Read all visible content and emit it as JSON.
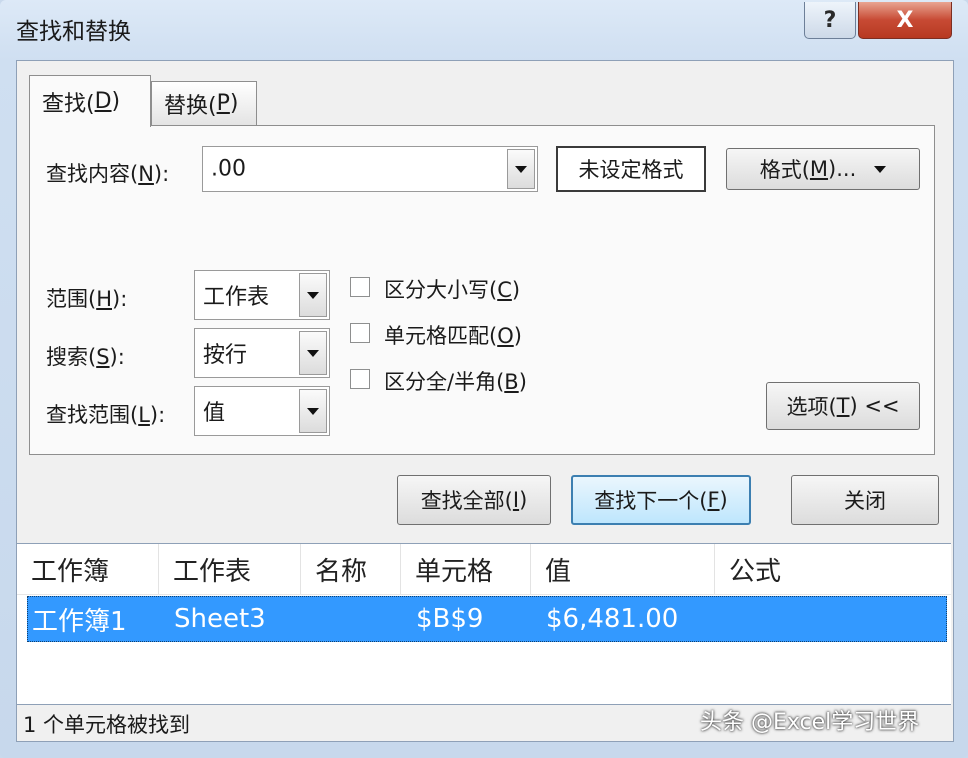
{
  "window": {
    "title": "查找和替换",
    "help_label": "?",
    "close_label": "X"
  },
  "tabs": [
    {
      "label": "查找(",
      "mnemonic": "D",
      "suffix": ")",
      "selected": true
    },
    {
      "label": "替换(",
      "mnemonic": "P",
      "suffix": ")",
      "selected": false
    }
  ],
  "find": {
    "label_pre": "查找内容(",
    "label_mn": "N",
    "label_post": "):",
    "value": ".00",
    "format_preview": "未设定格式",
    "format_btn_pre": "格式(",
    "format_btn_mn": "M",
    "format_btn_post": ")..."
  },
  "options": {
    "within": {
      "label_pre": "范围(",
      "label_mn": "H",
      "label_post": "):",
      "value": "工作表"
    },
    "search": {
      "label_pre": "搜索(",
      "label_mn": "S",
      "label_post": "):",
      "value": "按行"
    },
    "lookin": {
      "label_pre": "查找范围(",
      "label_mn": "L",
      "label_post": "):",
      "value": "值"
    },
    "match_case": {
      "pre": "区分大小写(",
      "mn": "C",
      "post": ")",
      "checked": false
    },
    "match_cell": {
      "pre": "单元格匹配(",
      "mn": "O",
      "post": ")",
      "checked": false
    },
    "match_width": {
      "pre": "区分全/半角(",
      "mn": "B",
      "post": ")",
      "checked": false
    },
    "options_btn_pre": "选项(",
    "options_btn_mn": "T",
    "options_btn_post": ") <<"
  },
  "actions": {
    "find_all": {
      "pre": "查找全部(",
      "mn": "I",
      "post": ")"
    },
    "find_next": {
      "pre": "查找下一个(",
      "mn": "F",
      "post": ")"
    },
    "close": "关闭"
  },
  "results": {
    "columns": [
      "工作簿",
      "工作表",
      "名称",
      "单元格",
      "值",
      "公式"
    ],
    "rows": [
      {
        "workbook": "工作簿1",
        "sheet": "Sheet3",
        "name": "",
        "cell": "$B$9",
        "value": "$6,481.00",
        "formula": ""
      }
    ]
  },
  "status": "1 个单元格被找到",
  "watermark": "头条 @Excel学习世界",
  "colors": {
    "selection": "#3399ff",
    "default_button_border": "#3c7fb1",
    "close_button": "#c74a34"
  }
}
